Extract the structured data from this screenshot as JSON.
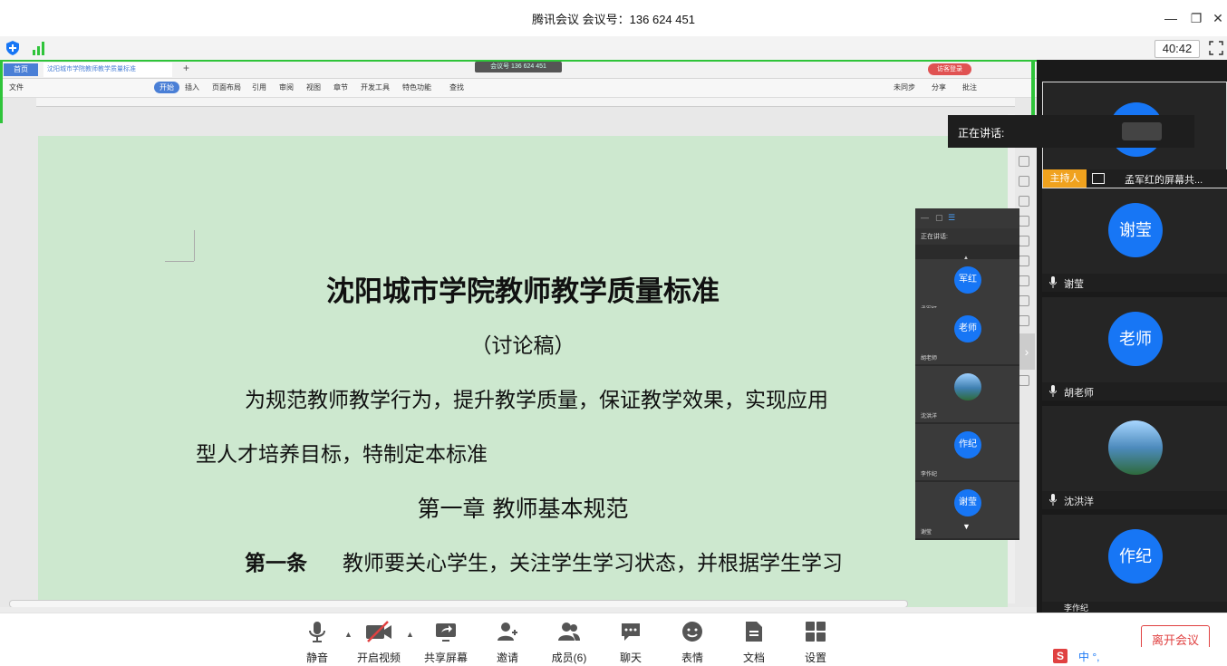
{
  "app": {
    "title": "腾讯会议 会议号：136 624 451",
    "timer": "40:42"
  },
  "wps": {
    "home_tab": "首页",
    "doc_tab": "沈阳城市学院教师教学质量标准",
    "meeting_pill": "会议号 136 624 451",
    "login": "访客登录",
    "menu": [
      "文件",
      "开始",
      "插入",
      "页面布局",
      "引用",
      "审阅",
      "视图",
      "章节",
      "开发工具",
      "特色功能",
      "查找"
    ],
    "menu_right": [
      "未同步",
      "分享",
      "批注"
    ]
  },
  "document": {
    "title": "沈阳城市学院教师教学质量标准",
    "subtitle": "（讨论稿）",
    "para1": "为规范教师教学行为，提升教学质量，保证教学效果，实现应用",
    "para2": "型人才培养目标，特制定本标准",
    "chapter": "第一章  教师基本规范",
    "article_label": "第一条",
    "article_text": "教师要关心学生，关注学生学习状态，并根据学生学习"
  },
  "floating_panel": {
    "speaking_label": "正在讲话:",
    "tiles": [
      {
        "avatar": "军红",
        "name": "孟军红"
      },
      {
        "avatar": "老师",
        "name": "胡老师"
      },
      {
        "avatar": "",
        "name": "沈洪洋"
      },
      {
        "avatar": "作纪",
        "name": "李作纪"
      },
      {
        "avatar": "谢莹",
        "name": "谢莹"
      }
    ]
  },
  "speaking_popup": {
    "label": "正在讲话:"
  },
  "participants": {
    "host_badge": "主持人",
    "host_name": "孟军红的屏幕共...",
    "tiles": [
      {
        "avatar": "谢莹",
        "name": "谢莹"
      },
      {
        "avatar": "老师",
        "name": "胡老师"
      },
      {
        "avatar": "",
        "name": "沈洪洋"
      },
      {
        "avatar": "作纪",
        "name": "李作纪"
      }
    ]
  },
  "toolbar": {
    "buttons": [
      {
        "label": "静音",
        "icon": "microphone-icon"
      },
      {
        "label": "开启视频",
        "icon": "video-off-icon"
      },
      {
        "label": "共享屏幕",
        "icon": "share-screen-icon"
      },
      {
        "label": "邀请",
        "icon": "invite-icon"
      },
      {
        "label": "成员(6)",
        "icon": "members-icon"
      },
      {
        "label": "聊天",
        "icon": "chat-icon"
      },
      {
        "label": "表情",
        "icon": "emoji-icon"
      },
      {
        "label": "文档",
        "icon": "document-icon"
      },
      {
        "label": "设置",
        "icon": "settings-icon"
      }
    ],
    "leave": "离开会议"
  },
  "ime": {
    "text": "中 °,"
  },
  "colors": {
    "accent": "#1776f5",
    "host": "#f0a21e",
    "leave": "#e04141",
    "page_bg": "#cde8cf",
    "green_border": "#2fc43a"
  }
}
